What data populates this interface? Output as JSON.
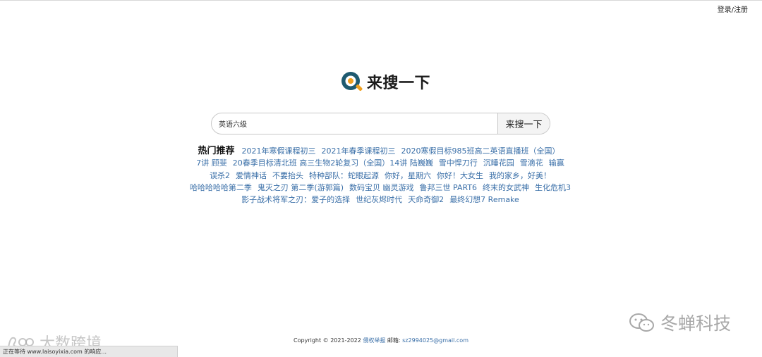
{
  "auth": {
    "label": "登录/注册"
  },
  "logo": {
    "text": "来搜一下",
    "accent": "#f0a020",
    "mark_color": "#1e5a70"
  },
  "search": {
    "value": "英语六级",
    "button_label": "来搜一下"
  },
  "hot": {
    "title": "热门推荐",
    "items": [
      "2021年寒假课程初三",
      "2021年春季课程初三",
      "2020寒假目标985班高二英语直播班（全国）",
      "7讲 顾斐",
      "20春季目标清北班 高三生物2轮复习（全国）14讲 陆巍巍",
      "雪中悍刀行",
      "沉睡花园",
      "雪滴花",
      "输赢",
      "误杀2",
      "爱情神话",
      "不要抬头",
      "特种部队：蛇眼起源",
      "你好，星期六",
      "你好！大女生",
      "我的家乡，好美！",
      "哈哈哈哈哈第二季",
      "鬼灭之刃 第二季(游郭篇)",
      "数码宝贝 幽灵游戏",
      "鲁邦三世 PART6",
      "终末的女武神",
      "生化危机3",
      "影子战术将军之刃：爱子的选择",
      "世纪灰烬时代",
      "天命奇御2",
      "最终幻想7 Remake"
    ]
  },
  "footer": {
    "copyright": "Copyright © 2021-2022",
    "report_link": "侵权举报",
    "email_label": "邮箱:",
    "email": "sz2994025@gmail.com"
  },
  "watermark": {
    "text": "冬蝉科技"
  },
  "left_watermark": {
    "text": "大数跨境"
  },
  "status_bar": {
    "text": "正在等待 www.laisoyixia.com 的响应..."
  }
}
